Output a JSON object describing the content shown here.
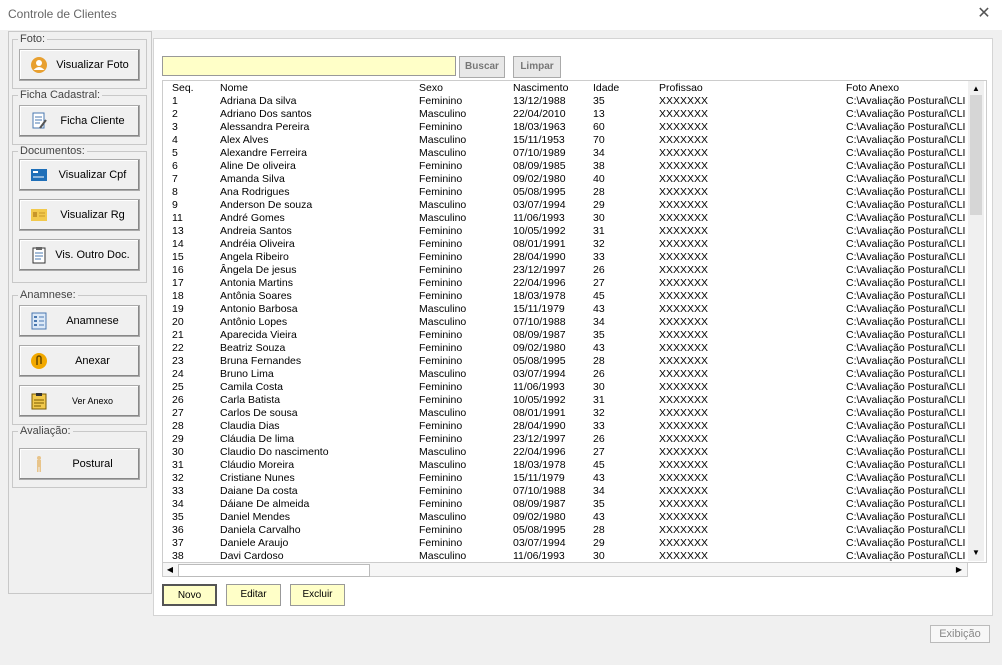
{
  "window": {
    "title": "Controle de Clientes"
  },
  "sidebar": {
    "foto": {
      "label": "Foto:",
      "btn_visualizar_foto": "Visualizar Foto"
    },
    "ficha": {
      "label": "Ficha Cadastral:",
      "btn_ficha_cliente": "Ficha Cliente"
    },
    "documentos": {
      "label": "Documentos:",
      "btn_cpf": "Visualizar Cpf",
      "btn_rg": "Visualizar Rg",
      "btn_outro": "Vis. Outro Doc."
    },
    "anamnese": {
      "label": "Anamnese:",
      "btn_anamnese": "Anamnese",
      "btn_anexar": "Anexar",
      "btn_ver_anexo": "Ver Anexo"
    },
    "avaliacao": {
      "label": "Avaliação:",
      "btn_postural": "Postural"
    }
  },
  "search": {
    "value": "",
    "buscar": "Buscar",
    "limpar": "Limpar"
  },
  "table": {
    "headers": [
      "Seq.",
      "Nome",
      "Sexo",
      "Nascimento",
      "Idade",
      "Profissao",
      "Foto Anexo"
    ],
    "rows": [
      [
        "1",
        "Adriana Da silva",
        "Feminino",
        "13/12/1988",
        "35",
        "XXXXXXX",
        "C:\\Avaliação Postural\\CLI"
      ],
      [
        "2",
        "Adriano Dos santos",
        "Masculino",
        "22/04/2010",
        "13",
        "XXXXXXX",
        "C:\\Avaliação Postural\\CLI"
      ],
      [
        "3",
        "Alessandra  Pereira",
        "Feminino",
        "18/03/1963",
        "60",
        "XXXXXXX",
        "C:\\Avaliação Postural\\CLI"
      ],
      [
        "4",
        "Alex  Alves",
        "Masculino",
        "15/11/1953",
        "70",
        "XXXXXXX",
        "C:\\Avaliação Postural\\CLI"
      ],
      [
        "5",
        "Alexandre  Ferreira",
        "Masculino",
        "07/10/1989",
        "34",
        "XXXXXXX",
        "C:\\Avaliação Postural\\CLI"
      ],
      [
        "6",
        "Aline De oliveira",
        "Feminino",
        "08/09/1985",
        "38",
        "XXXXXXX",
        "C:\\Avaliação Postural\\CLI"
      ],
      [
        "7",
        "Amanda  Silva",
        "Feminino",
        "09/02/1980",
        "40",
        "XXXXXXX",
        "C:\\Avaliação Postural\\CLI"
      ],
      [
        "8",
        "Ana  Rodrigues",
        "Feminino",
        "05/08/1995",
        "28",
        "XXXXXXX",
        "C:\\Avaliação Postural\\CLI"
      ],
      [
        "9",
        "Anderson De souza",
        "Masculino",
        "03/07/1994",
        "29",
        "XXXXXXX",
        "C:\\Avaliação Postural\\CLI"
      ],
      [
        "11",
        "André  Gomes",
        "Masculino",
        "11/06/1993",
        "30",
        "XXXXXXX",
        "C:\\Avaliação Postural\\CLI"
      ],
      [
        "13",
        "Andreia  Santos",
        "Feminino",
        "10/05/1992",
        "31",
        "XXXXXXX",
        "C:\\Avaliação Postural\\CLI"
      ],
      [
        "14",
        "Andréia  Oliveira",
        "Feminino",
        "08/01/1991",
        "32",
        "XXXXXXX",
        "C:\\Avaliação Postural\\CLI"
      ],
      [
        "15",
        "Angela  Ribeiro",
        "Feminino",
        "28/04/1990",
        "33",
        "XXXXXXX",
        "C:\\Avaliação Postural\\CLI"
      ],
      [
        "16",
        "Ângela  De jesus",
        "Feminino",
        "23/12/1997",
        "26",
        "XXXXXXX",
        "C:\\Avaliação Postural\\CLI"
      ],
      [
        "17",
        "Antonia  Martins",
        "Feminino",
        "22/04/1996",
        "27",
        "XXXXXXX",
        "C:\\Avaliação Postural\\CLI"
      ],
      [
        "18",
        "Antônia  Soares",
        "Feminino",
        "18/03/1978",
        "45",
        "XXXXXXX",
        "C:\\Avaliação Postural\\CLI"
      ],
      [
        "19",
        "Antonio  Barbosa",
        "Masculino",
        "15/11/1979",
        "43",
        "XXXXXXX",
        "C:\\Avaliação Postural\\CLI"
      ],
      [
        "20",
        "Antônio  Lopes",
        "Masculino",
        "07/10/1988",
        "34",
        "XXXXXXX",
        "C:\\Avaliação Postural\\CLI"
      ],
      [
        "21",
        "Aparecida  Vieira",
        "Feminino",
        "08/09/1987",
        "35",
        "XXXXXXX",
        "C:\\Avaliação Postural\\CLI"
      ],
      [
        "22",
        "Beatriz  Souza",
        "Feminino",
        "09/02/1980",
        "43",
        "XXXXXXX",
        "C:\\Avaliação Postural\\CLI"
      ],
      [
        "23",
        "Bruna  Fernandes",
        "Feminino",
        "05/08/1995",
        "28",
        "XXXXXXX",
        "C:\\Avaliação Postural\\CLI"
      ],
      [
        "24",
        "Bruno  Lima",
        "Masculino",
        "03/07/1994",
        "26",
        "XXXXXXX",
        "C:\\Avaliação Postural\\CLI"
      ],
      [
        "25",
        "Camila  Costa",
        "Feminino",
        "11/06/1993",
        "30",
        "XXXXXXX",
        "C:\\Avaliação Postural\\CLI"
      ],
      [
        "26",
        "Carla  Batista",
        "Feminino",
        "10/05/1992",
        "31",
        "XXXXXXX",
        "C:\\Avaliação Postural\\CLI"
      ],
      [
        "27",
        "Carlos  De sousa",
        "Masculino",
        "08/01/1991",
        "32",
        "XXXXXXX",
        "C:\\Avaliação Postural\\CLI"
      ],
      [
        "28",
        "Claudia  Dias",
        "Feminino",
        "28/04/1990",
        "33",
        "XXXXXXX",
        "C:\\Avaliação Postural\\CLI"
      ],
      [
        "29",
        "Cláudia  De lima",
        "Feminino",
        "23/12/1997",
        "26",
        "XXXXXXX",
        "C:\\Avaliação Postural\\CLI"
      ],
      [
        "30",
        "Claudio  Do nascimento",
        "Masculino",
        "22/04/1996",
        "27",
        "XXXXXXX",
        "C:\\Avaliação Postural\\CLI"
      ],
      [
        "31",
        "Cláudio  Moreira",
        "Masculino",
        "18/03/1978",
        "45",
        "XXXXXXX",
        "C:\\Avaliação Postural\\CLI"
      ],
      [
        "32",
        "Cristiane  Nunes",
        "Feminino",
        "15/11/1979",
        "43",
        "XXXXXXX",
        "C:\\Avaliação Postural\\CLI"
      ],
      [
        "33",
        "Daiane  Da costa",
        "Feminino",
        "07/10/1988",
        "34",
        "XXXXXXX",
        "C:\\Avaliação Postural\\CLI"
      ],
      [
        "34",
        "Dáiane  De almeida",
        "Feminino",
        "08/09/1987",
        "35",
        "XXXXXXX",
        "C:\\Avaliação Postural\\CLI"
      ],
      [
        "35",
        "Daniel  Mendes",
        "Masculino",
        "09/02/1980",
        "43",
        "XXXXXXX",
        "C:\\Avaliação Postural\\CLI"
      ],
      [
        "36",
        "Daniela  Carvalho",
        "Feminino",
        "05/08/1995",
        "28",
        "XXXXXXX",
        "C:\\Avaliação Postural\\CLI"
      ],
      [
        "37",
        "Daniele  Araujo",
        "Feminino",
        "03/07/1994",
        "29",
        "XXXXXXX",
        "C:\\Avaliação Postural\\CLI"
      ],
      [
        "38",
        "Davi  Cardoso",
        "Masculino",
        "11/06/1993",
        "30",
        "XXXXXXX",
        "C:\\Avaliação Postural\\CLI"
      ]
    ]
  },
  "actions": {
    "novo": "Novo",
    "editar": "Editar",
    "excluir": "Excluir"
  },
  "status": {
    "label": "Exibição"
  },
  "colors": {
    "input_bg": "#ffffc8",
    "button_bg": "#f0f0f0",
    "window_bg": "#f0f0f0"
  },
  "icons": [
    "close-icon",
    "user-photo-icon",
    "form-icon",
    "cpf-card-icon",
    "rg-card-icon",
    "clipboard-doc-icon",
    "checklist-icon",
    "paperclip-icon",
    "attachment-view-icon",
    "posture-figure-icon",
    "scroll-up-icon",
    "scroll-down-icon",
    "scroll-left-icon",
    "scroll-right-icon"
  ]
}
